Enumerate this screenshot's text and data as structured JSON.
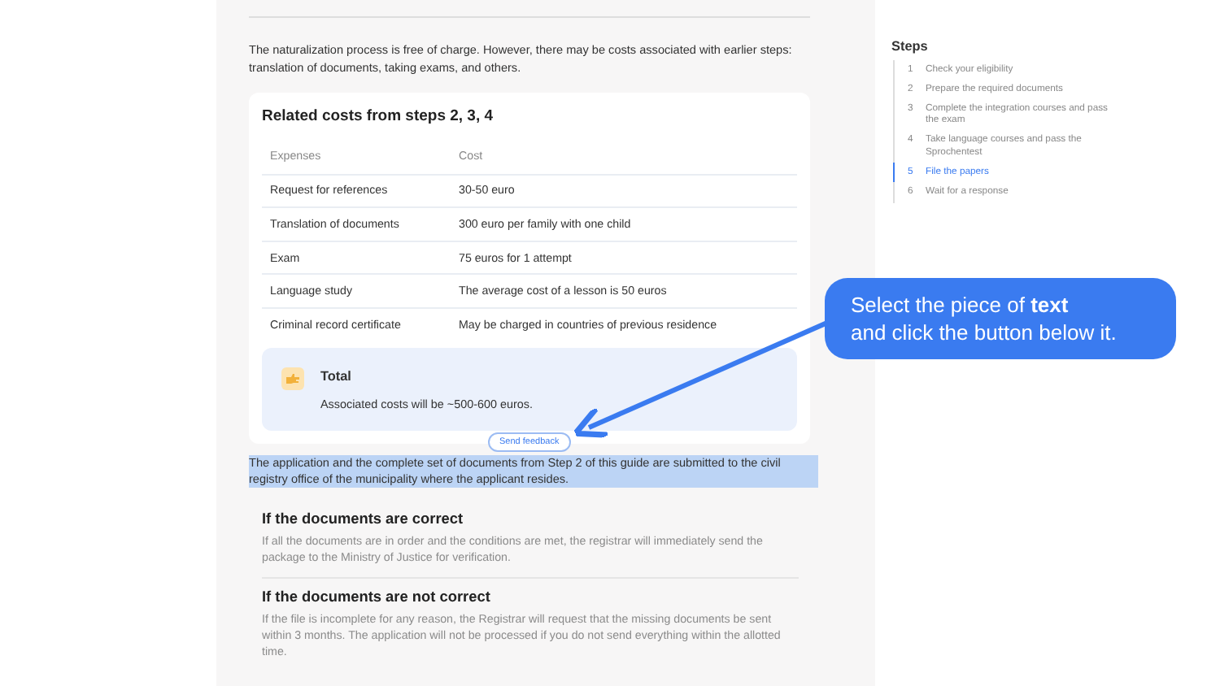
{
  "intro": "The naturalization process is free of charge. However, there may be costs associated with earlier steps: translation of documents, taking exams, and others.",
  "costs": {
    "title": "Related costs from steps 2, 3, 4",
    "columns": [
      "Expenses",
      "Cost"
    ],
    "rows": [
      [
        "Request for references",
        "30-50 euro"
      ],
      [
        "Translation of documents",
        "300 euro per family with one child"
      ],
      [
        "Exam",
        "75 euros for 1 attempt"
      ],
      [
        "Language study",
        "The average cost of a lesson is 50 euros"
      ],
      [
        "Criminal record certificate",
        "May be charged in countries of previous residence"
      ]
    ],
    "total": {
      "title": "Total",
      "text": "Associated costs will be ~500-600 euros."
    }
  },
  "feedback_button": "Send feedback",
  "selected_paragraph": {
    "text": "The application and the complete set of documents from Step 2 of this guide are submitted to the civil registry office of the municipality where the applicant resides.",
    "selected": true
  },
  "sections": [
    {
      "title": "If the documents are correct",
      "text": "If all the documents are in order and the conditions are met, the registrar will immediately send the package to the Ministry of Justice for verification."
    },
    {
      "title": "If the documents are not correct",
      "text": "If the file is incomplete for any reason, the Registrar will request that the missing documents be sent within 3 months. The application will not be processed if you do not send everything within the allotted time."
    }
  ],
  "sidebar": {
    "title": "Steps",
    "steps": [
      {
        "number": "1",
        "label": "Check your eligibility",
        "selected": false
      },
      {
        "number": "2",
        "label": "Prepare the required documents",
        "selected": false
      },
      {
        "number": "3",
        "label": "Complete the integration courses and pass the exam",
        "selected": false
      },
      {
        "number": "4",
        "label": "Take language courses and pass the Sprochentest",
        "selected": false
      },
      {
        "number": "5",
        "label": "File the papers",
        "selected": true
      },
      {
        "number": "6",
        "label": "Wait for a response",
        "selected": false
      }
    ]
  },
  "callout": {
    "lines": [
      "Select the piece of **text**",
      "and click the button below it."
    ]
  }
}
